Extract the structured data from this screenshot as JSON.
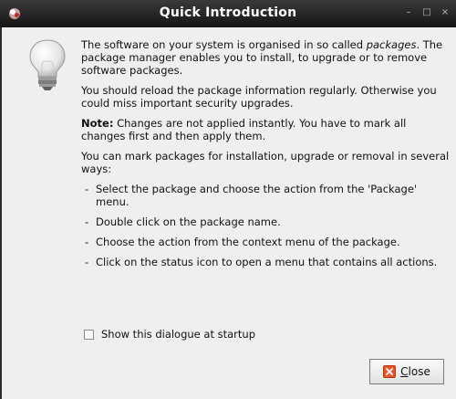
{
  "window": {
    "title": "Quick Introduction",
    "minimize_glyph": "–",
    "maximize_glyph": "□",
    "close_glyph": "×"
  },
  "content": {
    "p1_before": "The software on your system is organised in so called ",
    "p1_em": "packages",
    "p1_after": ". The package manager enables you to install, to upgrade or to remove software packages.",
    "p2": "You should reload the package information regularly. Otherwise you could miss important security upgrades.",
    "p3_bold": "Note:",
    "p3_rest": " Changes are not applied instantly. You have to mark all changes first and then apply them.",
    "p4": "You can mark packages for installation, upgrade or removal in several ways:",
    "items": [
      "Select the package and choose the action from the 'Package' menu.",
      "Double click on the package name.",
      "Choose the action from the context menu of the package.",
      "Click on the status icon to open a menu that contains all actions."
    ]
  },
  "checkbox": {
    "label": "Show this dialogue at startup",
    "checked": false
  },
  "close_button": {
    "label": "Close",
    "icon": "close-icon"
  },
  "colors": {
    "titlebar": "#1e1e1e",
    "window_bg": "#efefef",
    "icon_accent": "#e8552b"
  }
}
